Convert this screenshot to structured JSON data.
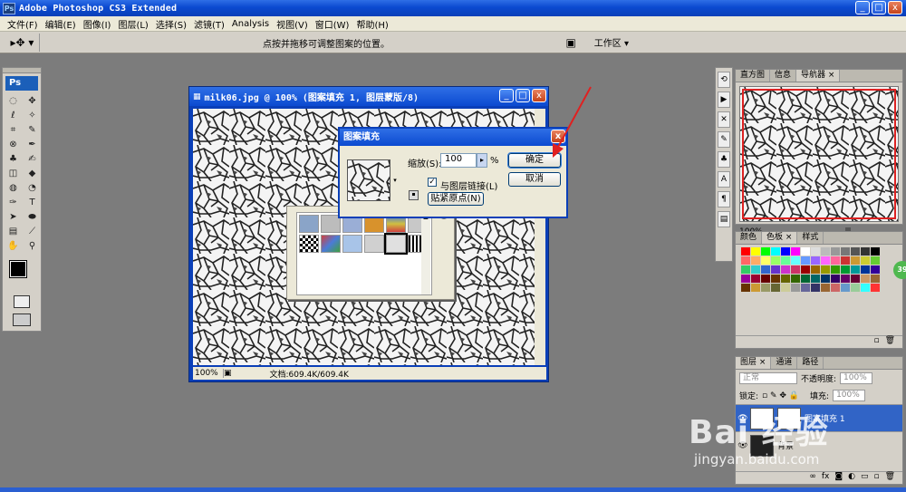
{
  "app": {
    "title": "Adobe Photoshop CS3 Extended",
    "logo": "Ps",
    "window_buttons": [
      "_",
      "□",
      "x"
    ]
  },
  "menu": [
    "文件(F)",
    "编辑(E)",
    "图像(I)",
    "图层(L)",
    "选择(S)",
    "滤镜(T)",
    "Analysis",
    "视图(V)",
    "窗口(W)",
    "帮助(H)"
  ],
  "options": {
    "hint": "点按并拖移可调整图案的位置。",
    "workspace": "工作区 ▾"
  },
  "document": {
    "title": "milk06.jpg @ 100% (图案填充 1, 图层蒙版/8)",
    "zoom": "100%",
    "info": "文档:609.4K/609.4K"
  },
  "dialog": {
    "title": "图案填充",
    "scale_label": "缩放(S):",
    "scale_value": "100",
    "percent": "%",
    "link_label": "与图层链接(L)",
    "snap_label": "贴紧原点(N)",
    "ok": "确定",
    "cancel": "取消"
  },
  "panels": {
    "top_tabs": [
      "直方图",
      "信息",
      "导航器 ×"
    ],
    "nav_zoom": "100%",
    "color_tabs": [
      "颜色",
      "色板 ×",
      "样式"
    ],
    "layers_tabs": [
      "图层 ×",
      "通道",
      "路径"
    ],
    "blend_mode": "正常",
    "opacity_label": "不透明度:",
    "opacity_value": "100%",
    "lock_label": "锁定:",
    "fill_label": "填充:",
    "fill_value": "100%",
    "layer1_name": "图案填充 1",
    "layer2_name": "背景"
  },
  "watermark": {
    "main": "Bai 经验",
    "sub": "jingyan.baidu.com"
  },
  "badge": "39"
}
